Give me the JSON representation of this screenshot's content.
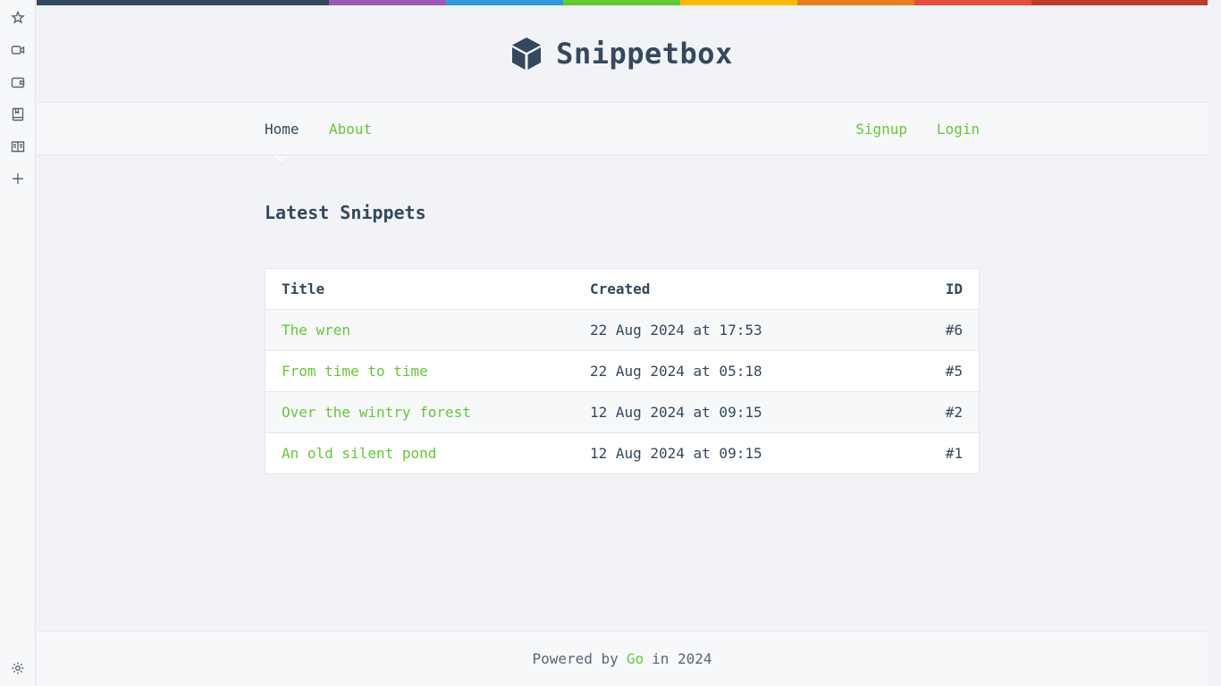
{
  "sidebar": {
    "icons": [
      "sparkle-icon",
      "video-icon",
      "wallet-icon",
      "bookmark-icon",
      "book-icon",
      "plus-icon",
      "gear-icon"
    ]
  },
  "brand": {
    "title": "Snippetbox",
    "icon": "cube-icon"
  },
  "rainbow_colors": [
    "#34495e",
    "#9b59b6",
    "#3498db",
    "#62cb31",
    "#ffb606",
    "#e67e22",
    "#e74c3c",
    "#c0392b"
  ],
  "nav": {
    "home": "Home",
    "about": "About",
    "signup": "Signup",
    "login": "Login"
  },
  "main": {
    "title": "Latest Snippets",
    "table": {
      "headers": [
        "Title",
        "Created",
        "ID"
      ],
      "rows": [
        {
          "title": "The wren",
          "created": "22 Aug 2024 at 17:53",
          "id": "#6"
        },
        {
          "title": "From time to time",
          "created": "22 Aug 2024 at 05:18",
          "id": "#5"
        },
        {
          "title": "Over the wintry forest",
          "created": "12 Aug 2024 at 09:15",
          "id": "#2"
        },
        {
          "title": "An old silent pond",
          "created": "12 Aug 2024 at 09:15",
          "id": "#1"
        }
      ]
    }
  },
  "footer": {
    "prefix": "Powered by",
    "link": "Go",
    "suffix": "in 2024"
  },
  "colors": {
    "accent": "#62cb31",
    "text": "#34495e"
  }
}
